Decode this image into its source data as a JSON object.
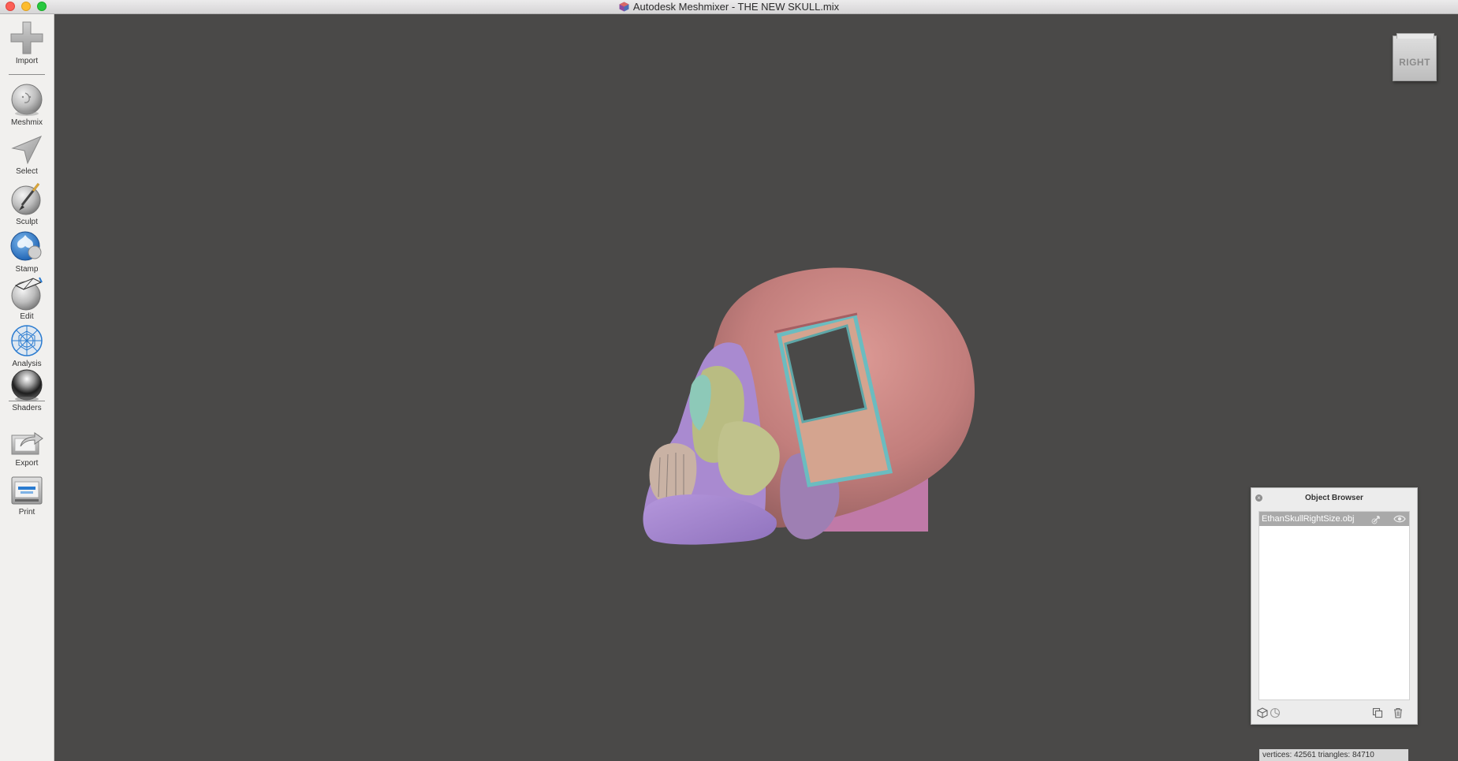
{
  "window": {
    "title": "Autodesk Meshmixer - THE NEW SKULL.mix"
  },
  "toolbar": {
    "items": [
      {
        "label": "Import",
        "icon": "plus-icon"
      },
      {
        "label": "Meshmix",
        "icon": "meshmix-sphere-icon"
      },
      {
        "label": "Select",
        "icon": "select-arrow-icon"
      },
      {
        "label": "Sculpt",
        "icon": "sculpt-brush-icon"
      },
      {
        "label": "Stamp",
        "icon": "stamp-icon"
      },
      {
        "label": "Edit",
        "icon": "edit-sphere-icon"
      },
      {
        "label": "Analysis",
        "icon": "analysis-mesh-icon"
      },
      {
        "label": "Shaders",
        "icon": "shaders-sphere-icon"
      },
      {
        "label": "Export",
        "icon": "export-icon"
      },
      {
        "label": "Print",
        "icon": "print-icon"
      }
    ]
  },
  "viewcube": {
    "label": "RIGHT"
  },
  "object_browser": {
    "title": "Object Browser",
    "items": [
      {
        "name": "EthanSkullRightSize.obj",
        "selected": true
      }
    ]
  },
  "status": {
    "text": "vertices: 42561 triangles: 84710"
  },
  "colors": {
    "viewport_bg": "#4a4948",
    "skull_pink": "#c27e7c",
    "face_lavender": "#a98ad0",
    "face_olive": "#b9bc82",
    "face_teal": "#8dc9b8",
    "frame_teal": "#6bbcc0"
  }
}
